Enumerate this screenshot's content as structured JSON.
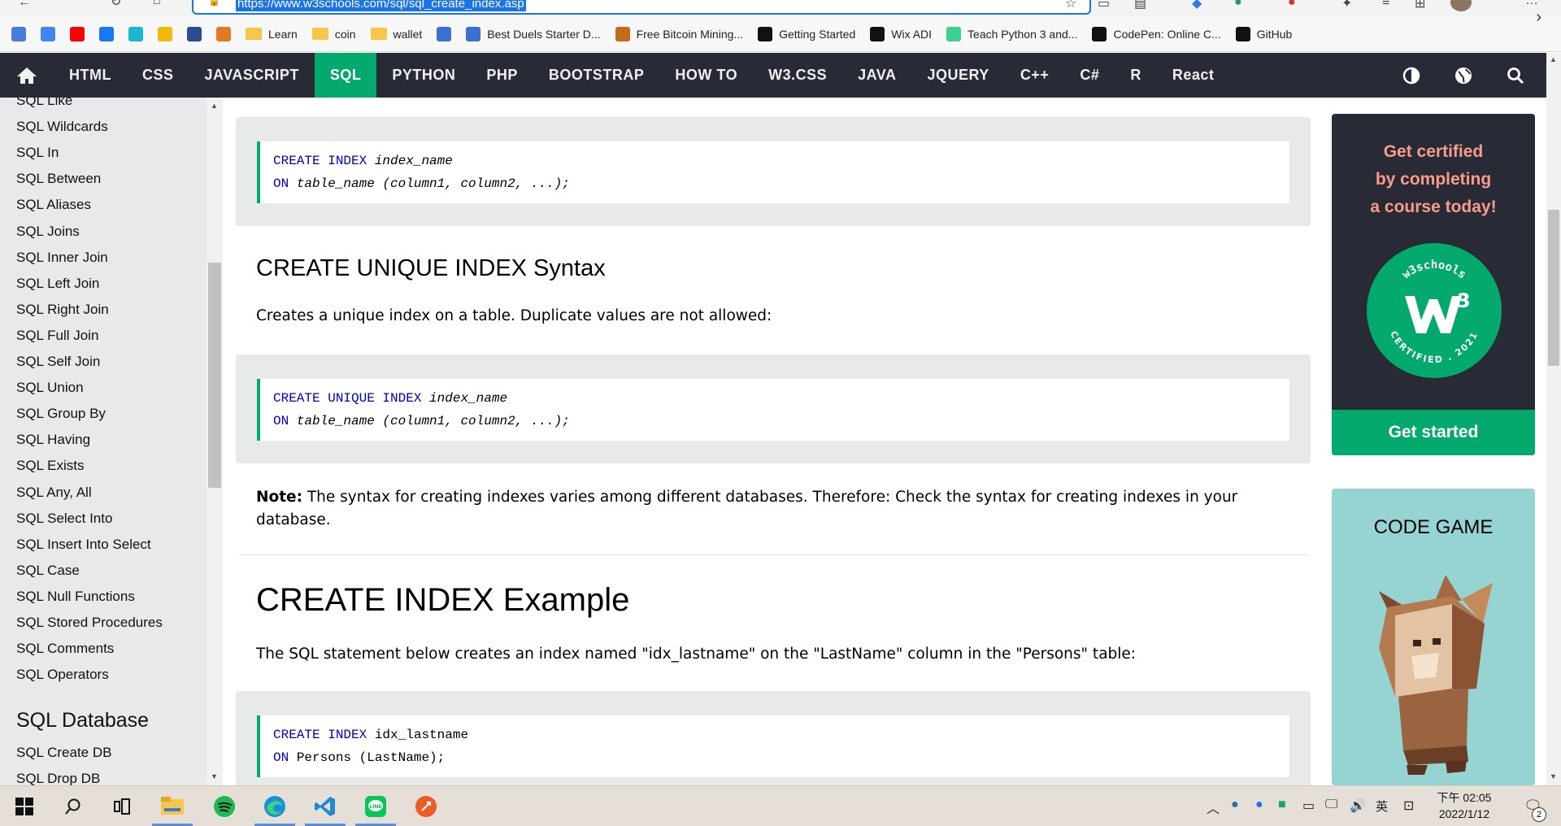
{
  "browser": {
    "url": "https://www.w3schools.com/sql/sql_create_index.asp",
    "bookmarks": [
      {
        "label": "",
        "icon": "microsoft-translator-icon",
        "color": "#4a7cdc"
      },
      {
        "label": "",
        "icon": "google-icon",
        "color": "#4285f4"
      },
      {
        "label": "",
        "icon": "youtube-icon",
        "color": "#ff0000"
      },
      {
        "label": "",
        "icon": "facebook-icon",
        "color": "#1877f2"
      },
      {
        "label": "",
        "icon": "tool-icon",
        "color": "#19b7d0"
      },
      {
        "label": "",
        "icon": "binance-icon",
        "color": "#f0b90b"
      },
      {
        "label": "",
        "icon": "app-icon",
        "color": "#2a4d8f"
      },
      {
        "label": "",
        "icon": "fox-icon",
        "color": "#e07b22"
      },
      {
        "label": "Learn",
        "icon": "folder-icon"
      },
      {
        "label": "coin",
        "icon": "folder-icon"
      },
      {
        "label": "wallet",
        "icon": "folder-icon"
      },
      {
        "label": "",
        "icon": "settings-icon",
        "color": "#3b6fd1"
      },
      {
        "label": "Best Duels Starter D...",
        "icon": "gear-icon",
        "color": "#3b6fd1"
      },
      {
        "label": "Free Bitcoin Mining...",
        "icon": "mining-icon",
        "color": "#c46a1c"
      },
      {
        "label": "Getting Started",
        "icon": "notion-icon",
        "color": "#111111"
      },
      {
        "label": "Wix ADI",
        "icon": "wix-icon",
        "color": "#111111"
      },
      {
        "label": "Teach Python 3 and...",
        "icon": "python-icon",
        "color": "#3fcf8e"
      },
      {
        "label": "CodePen: Online C...",
        "icon": "codepen-icon",
        "color": "#111111"
      },
      {
        "label": "GitHub",
        "icon": "github-icon",
        "color": "#111111"
      }
    ]
  },
  "nav": {
    "items": [
      "HTML",
      "CSS",
      "JAVASCRIPT",
      "SQL",
      "PYTHON",
      "PHP",
      "BOOTSTRAP",
      "HOW TO",
      "W3.CSS",
      "JAVA",
      "JQUERY",
      "C++",
      "C#",
      "R",
      "React"
    ],
    "active": "SQL"
  },
  "sidebar": {
    "links": [
      "SQL Like",
      "SQL Wildcards",
      "SQL In",
      "SQL Between",
      "SQL Aliases",
      "SQL Joins",
      "SQL Inner Join",
      "SQL Left Join",
      "SQL Right Join",
      "SQL Full Join",
      "SQL Self Join",
      "SQL Union",
      "SQL Group By",
      "SQL Having",
      "SQL Exists",
      "SQL Any, All",
      "SQL Select Into",
      "SQL Insert Into Select",
      "SQL Case",
      "SQL Null Functions",
      "SQL Stored Procedures",
      "SQL Comments",
      "SQL Operators"
    ],
    "heading": "SQL Database",
    "links2": [
      "SQL Create DB",
      "SQL Drop DB"
    ]
  },
  "main": {
    "code1": {
      "l1_kw": "CREATE INDEX",
      "l1_rest": "index_name",
      "l2_kw": "ON",
      "l2_rest": "table_name (column1, column2, ...);"
    },
    "unique_heading": "CREATE UNIQUE INDEX Syntax",
    "unique_desc": "Creates a unique index on a table. Duplicate values are not allowed:",
    "code2": {
      "l1_kw": "CREATE UNIQUE INDEX",
      "l1_rest": "index_name",
      "l2_kw": "ON",
      "l2_rest": "table_name (column1, column2, ...);"
    },
    "note_label": "Note:",
    "note_text": " The syntax for creating indexes varies among different databases. Therefore: Check the syntax for creating indexes in your database.",
    "example_heading": "CREATE INDEX Example",
    "example_desc": "The SQL statement below creates an index named \"idx_lastname\" on the \"LastName\" column in the \"Persons\" table:",
    "code3": {
      "l1_kw": "CREATE INDEX",
      "l1_rest": "idx_lastname",
      "l2_kw": "ON",
      "l2_rest": "Persons (LastName);"
    }
  },
  "ads": {
    "cert_lines": [
      "Get certified",
      "by completing",
      "a course today!"
    ],
    "badge_top": "w3schools",
    "badge_bottom": "CERTIFIED . 2021",
    "cert_button": "Get started",
    "game_title": "CODE GAME"
  },
  "taskbar": {
    "time": "下午 02:05",
    "date": "2022/1/12",
    "ime": "英",
    "notifications": "2"
  },
  "colors": {
    "accent": "#04aa6d",
    "nav_bg": "#282a35",
    "sidebar_bg": "#e7e9eb",
    "keyword": "#0000cd"
  }
}
